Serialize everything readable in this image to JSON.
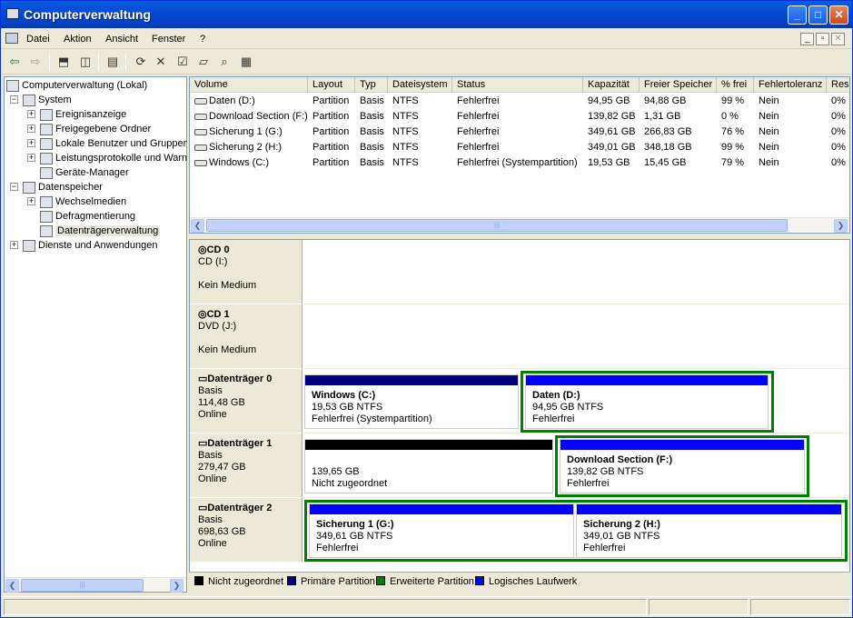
{
  "window": {
    "title": "Computerverwaltung"
  },
  "menu": [
    "Datei",
    "Aktion",
    "Ansicht",
    "Fenster",
    "?"
  ],
  "tree": {
    "root": "Computerverwaltung (Lokal)",
    "system": "System",
    "system_children": [
      "Ereignisanzeige",
      "Freigegebene Ordner",
      "Lokale Benutzer und Gruppen",
      "Leistungsprotokolle und Warnungen",
      "Geräte-Manager"
    ],
    "storage": "Datenspeicher",
    "storage_children": [
      "Wechselmedien",
      "Defragmentierung",
      "Datenträgerverwaltung"
    ],
    "services": "Dienste und Anwendungen"
  },
  "volumes": {
    "columns": [
      "Volume",
      "Layout",
      "Typ",
      "Dateisystem",
      "Status",
      "Kapazität",
      "Freier Speicher",
      "% frei",
      "Fehlertoleranz",
      "Res"
    ],
    "rows": [
      [
        "Daten (D:)",
        "Partition",
        "Basis",
        "NTFS",
        "Fehlerfrei",
        "94,95 GB",
        "94,88 GB",
        "99 %",
        "Nein",
        "0%"
      ],
      [
        "Download Section (F:)",
        "Partition",
        "Basis",
        "NTFS",
        "Fehlerfrei",
        "139,82 GB",
        "1,31 GB",
        "0 %",
        "Nein",
        "0%"
      ],
      [
        "Sicherung 1 (G:)",
        "Partition",
        "Basis",
        "NTFS",
        "Fehlerfrei",
        "349,61 GB",
        "266,83 GB",
        "76 %",
        "Nein",
        "0%"
      ],
      [
        "Sicherung 2 (H:)",
        "Partition",
        "Basis",
        "NTFS",
        "Fehlerfrei",
        "349,01 GB",
        "348,18 GB",
        "99 %",
        "Nein",
        "0%"
      ],
      [
        "Windows (C:)",
        "Partition",
        "Basis",
        "NTFS",
        "Fehlerfrei (Systempartition)",
        "19,53 GB",
        "15,45 GB",
        "79 %",
        "Nein",
        "0%"
      ]
    ]
  },
  "disks": [
    {
      "name": "CD 0",
      "l1": "CD (I:)",
      "l2": "",
      "l3": "Kein Medium"
    },
    {
      "name": "CD 1",
      "l1": "DVD (J:)",
      "l2": "",
      "l3": "Kein Medium"
    },
    {
      "name": "Datenträger 0",
      "l1": "Basis",
      "l2": "114,48 GB",
      "l3": "Online"
    },
    {
      "name": "Datenträger 1",
      "l1": "Basis",
      "l2": "279,47 GB",
      "l3": "Online"
    },
    {
      "name": "Datenträger 2",
      "l1": "Basis",
      "l2": "698,63 GB",
      "l3": "Online"
    }
  ],
  "partitions": {
    "windows": {
      "name": "Windows  (C:)",
      "size": "19,53 GB NTFS",
      "status": "Fehlerfrei (Systempartition)"
    },
    "daten": {
      "name": "Daten  (D:)",
      "size": "94,95 GB NTFS",
      "status": "Fehlerfrei"
    },
    "unalloc": {
      "name": "",
      "size": "139,65 GB",
      "status": "Nicht zugeordnet"
    },
    "download": {
      "name": "Download Section  (F:)",
      "size": "139,82 GB NTFS",
      "status": "Fehlerfrei"
    },
    "sich1": {
      "name": "Sicherung 1  (G:)",
      "size": "349,61 GB NTFS",
      "status": "Fehlerfrei"
    },
    "sich2": {
      "name": "Sicherung 2  (H:)",
      "size": "349,01 GB NTFS",
      "status": "Fehlerfrei"
    }
  },
  "legend": [
    "Nicht zugeordnet",
    "Primäre Partition",
    "Erweiterte Partition",
    "Logisches Laufwerk"
  ],
  "colors": {
    "unallocated": "#000000",
    "primary": "#000080",
    "extended": "#008000",
    "logical": "#0000ff",
    "titlebar": "#0549d3"
  }
}
